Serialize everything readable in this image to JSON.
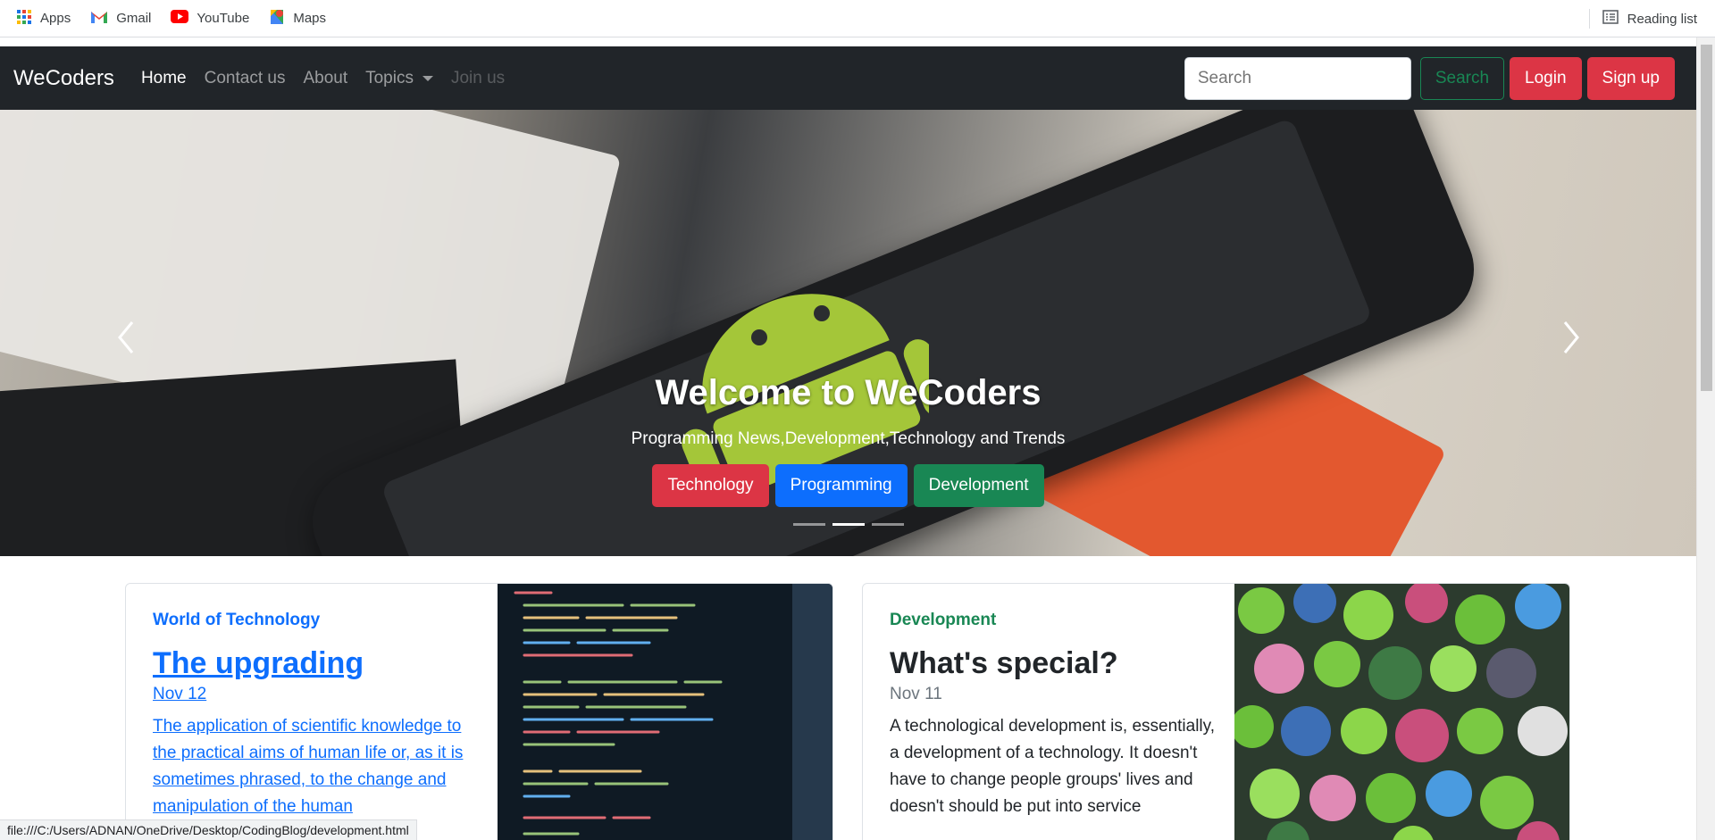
{
  "bookmarks": {
    "items": [
      {
        "label": "Apps",
        "icon": "apps-grid-icon"
      },
      {
        "label": "Gmail",
        "icon": "gmail-icon"
      },
      {
        "label": "YouTube",
        "icon": "youtube-icon"
      },
      {
        "label": "Maps",
        "icon": "maps-icon"
      }
    ],
    "reading_list": "Reading list"
  },
  "navbar": {
    "brand": "WeCoders",
    "links": [
      "Home",
      "Contact us",
      "About",
      "Topics",
      "Join us"
    ],
    "search_placeholder": "Search",
    "search_button": "Search",
    "login": "Login",
    "signup": "Sign up"
  },
  "carousel": {
    "title": "Welcome to WeCoders",
    "subtitle": "Programming News,Development,Technology and Trends",
    "buttons": [
      "Technology",
      "Programming",
      "Development"
    ],
    "indicator_count": 3,
    "active_indicator": 1
  },
  "cards": [
    {
      "category": "World of Technology",
      "title": "The upgrading",
      "date": "Nov 12",
      "text": "The application of scientific knowledge to the practical aims of human life or, as it is sometimes phrased, to the change and manipulation of the human"
    },
    {
      "category": "Development",
      "title": "What's special?",
      "date": "Nov 11",
      "text": "A technological development is, essentially, a development of a technology. It doesn't have to change people groups' lives and doesn't should be put into service"
    }
  ],
  "status_url": "file:///C:/Users/ADNAN/OneDrive/Desktop/CodingBlog/development.html",
  "colors": {
    "navbar_bg": "#212529",
    "danger": "#dc3545",
    "primary": "#0d6efd",
    "success": "#198754"
  }
}
